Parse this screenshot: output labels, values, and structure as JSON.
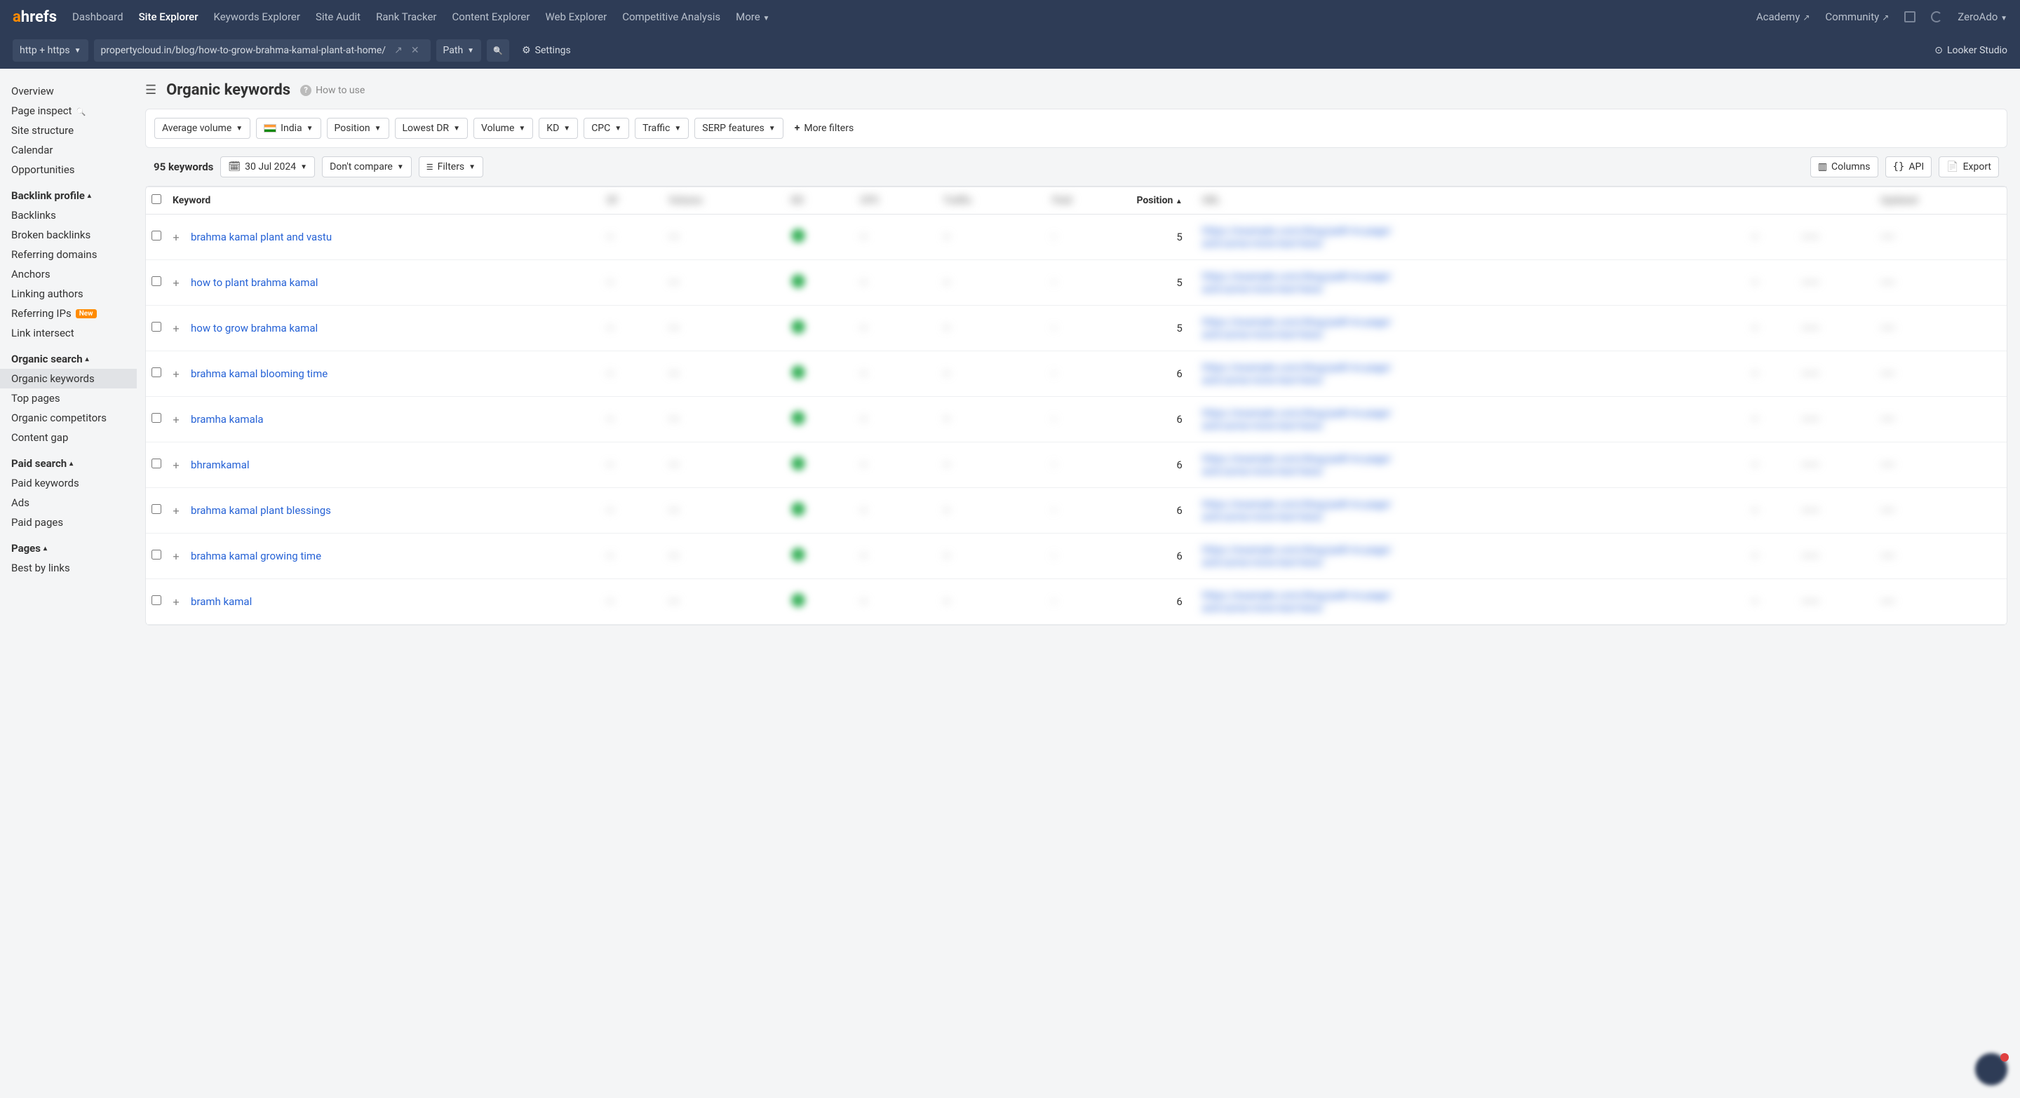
{
  "logo": {
    "a": "a",
    "rest": "hrefs"
  },
  "topnav": {
    "items": [
      "Dashboard",
      "Site Explorer",
      "Keywords Explorer",
      "Site Audit",
      "Rank Tracker",
      "Content Explorer",
      "Web Explorer",
      "Competitive Analysis",
      "More"
    ],
    "active_index": 1,
    "right": [
      "Academy",
      "Community"
    ],
    "account": "ZeroAdo"
  },
  "subnav": {
    "protocol": "http + https",
    "url": "propertycloud.in/blog/how-to-grow-brahma-kamal-plant-at-home/",
    "mode": "Path",
    "settings": "Settings",
    "looker": "Looker Studio"
  },
  "sidebar": {
    "top": [
      {
        "label": "Overview"
      },
      {
        "label": "Page inspect",
        "icon": "search"
      },
      {
        "label": "Site structure"
      },
      {
        "label": "Calendar"
      },
      {
        "label": "Opportunities"
      }
    ],
    "sections": [
      {
        "title": "Backlink profile",
        "items": [
          {
            "label": "Backlinks"
          },
          {
            "label": "Broken backlinks"
          },
          {
            "label": "Referring domains"
          },
          {
            "label": "Anchors"
          },
          {
            "label": "Linking authors"
          },
          {
            "label": "Referring IPs",
            "badge": "New"
          },
          {
            "label": "Link intersect"
          }
        ]
      },
      {
        "title": "Organic search",
        "items": [
          {
            "label": "Organic keywords",
            "active": true
          },
          {
            "label": "Top pages"
          },
          {
            "label": "Organic competitors"
          },
          {
            "label": "Content gap"
          }
        ]
      },
      {
        "title": "Paid search",
        "items": [
          {
            "label": "Paid keywords"
          },
          {
            "label": "Ads"
          },
          {
            "label": "Paid pages"
          }
        ]
      },
      {
        "title": "Pages",
        "items": [
          {
            "label": "Best by links"
          }
        ]
      }
    ]
  },
  "page": {
    "title": "Organic keywords",
    "howto": "How to use"
  },
  "filters": {
    "volume_mode": "Average volume",
    "country": "India",
    "items": [
      "Position",
      "Lowest DR",
      "Volume",
      "KD",
      "CPC",
      "Traffic",
      "SERP features"
    ],
    "more": "More filters"
  },
  "controls": {
    "count": "95 keywords",
    "date": "30 Jul 2024",
    "compare": "Don't compare",
    "filters": "Filters",
    "columns": "Columns",
    "api": "API",
    "export": "Export"
  },
  "table": {
    "headers": {
      "keyword": "Keyword",
      "position": "Position"
    },
    "rows": [
      {
        "keyword": "brahma kamal plant and vastu",
        "position": 5
      },
      {
        "keyword": "how to plant brahma kamal",
        "position": 5
      },
      {
        "keyword": "how to grow brahma kamal",
        "position": 5
      },
      {
        "keyword": "brahma kamal blooming time",
        "position": 6
      },
      {
        "keyword": "bramha kamala",
        "position": 6
      },
      {
        "keyword": "bhramkamal",
        "position": 6
      },
      {
        "keyword": "brahma kamal plant blessings",
        "position": 6
      },
      {
        "keyword": "brahma kamal growing time",
        "position": 6
      },
      {
        "keyword": "bramh kamal",
        "position": 6
      }
    ]
  }
}
